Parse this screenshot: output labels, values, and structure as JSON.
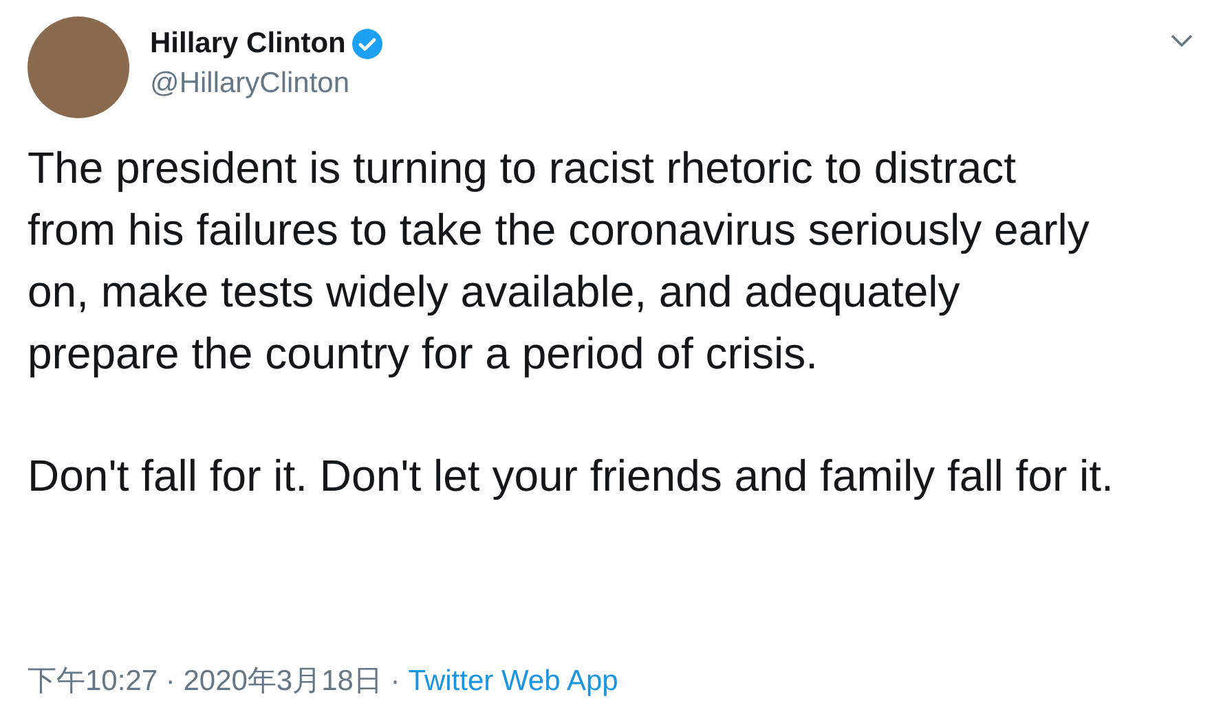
{
  "author": {
    "name": "Hillary Clinton",
    "verified": true,
    "handle": "@HillaryClinton"
  },
  "paragraphs": [
    "The president is turning to racist rhetoric to distract from his failures to take the coronavirus seriously early on, make tests widely available, and adequately prepare the country for a period of crisis.",
    "Don't fall for it. Don't let your friends and family fall for it."
  ],
  "footer": {
    "timestamp": "下午10:27 · 2020年3月18日 ·",
    "source": "Twitter Web App"
  }
}
